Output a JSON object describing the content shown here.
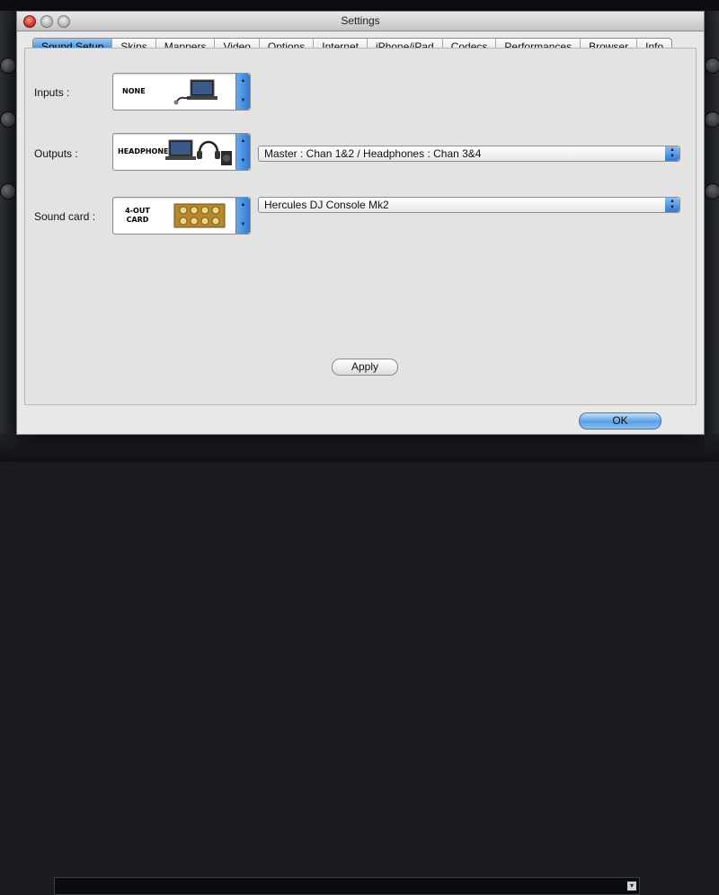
{
  "window": {
    "title": "Settings"
  },
  "tabs": [
    {
      "label": "Sound Setup",
      "active": true
    },
    {
      "label": "Skins",
      "active": false
    },
    {
      "label": "Mappers",
      "active": false
    },
    {
      "label": "Video",
      "active": false
    },
    {
      "label": "Options",
      "active": false
    },
    {
      "label": "Internet",
      "active": false
    },
    {
      "label": "iPhone/iPad",
      "active": false
    },
    {
      "label": "Codecs",
      "active": false
    },
    {
      "label": "Performances",
      "active": false
    },
    {
      "label": "Browser",
      "active": false
    },
    {
      "label": "Info",
      "active": false
    }
  ],
  "inputs": {
    "label": "Inputs :",
    "image_text": "NONE"
  },
  "outputs": {
    "label": "Outputs :",
    "image_text": "HEADPHONES",
    "selected": "Master : Chan 1&2 / Headphones : Chan 3&4"
  },
  "soundcard": {
    "label": "Sound card :",
    "image_text": "4-OUT CARD",
    "selected": "Hercules DJ Console Mk2"
  },
  "buttons": {
    "apply": "Apply",
    "ok": "OK"
  },
  "colors": {
    "accent": "#4a92dc",
    "close": "#d2332a"
  }
}
